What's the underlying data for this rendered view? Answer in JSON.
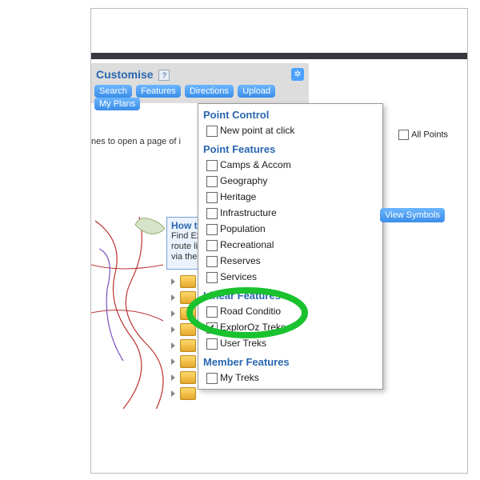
{
  "topbar": {
    "title": "Customise",
    "tabs": [
      "Search",
      "Features",
      "Directions",
      "Upload",
      "My Plans"
    ],
    "gear_icon": "gear"
  },
  "hint_text": "nes to open a page of i",
  "how_box": {
    "title": "How t",
    "desc1": "Find Exp",
    "desc2": "route lin",
    "desc3": "via the s"
  },
  "panel": {
    "sections": {
      "point_control": {
        "heading": "Point Control",
        "items": [
          {
            "label": "New point at click",
            "checked": false
          }
        ]
      },
      "point_features": {
        "heading": "Point Features",
        "items": [
          {
            "label": "Camps & Accom",
            "checked": false
          },
          {
            "label": "Geography",
            "checked": false
          },
          {
            "label": "Heritage",
            "checked": false
          },
          {
            "label": "Infrastructure",
            "checked": false
          },
          {
            "label": "Population",
            "checked": false
          },
          {
            "label": "Recreational",
            "checked": false
          },
          {
            "label": "Reserves",
            "checked": false
          },
          {
            "label": "Services",
            "checked": false
          }
        ]
      },
      "linear_features": {
        "heading": "Linear Features",
        "items": [
          {
            "label": "Road Conditio",
            "checked": false
          },
          {
            "label": "ExplorOz Treks",
            "checked": true
          },
          {
            "label": "User Treks",
            "checked": false
          }
        ]
      },
      "member_features": {
        "heading": "Member Features",
        "items": [
          {
            "label": "My Treks",
            "checked": false
          }
        ]
      }
    },
    "all_points_label": "All Points",
    "view_symbols_label": "View Symbols"
  }
}
